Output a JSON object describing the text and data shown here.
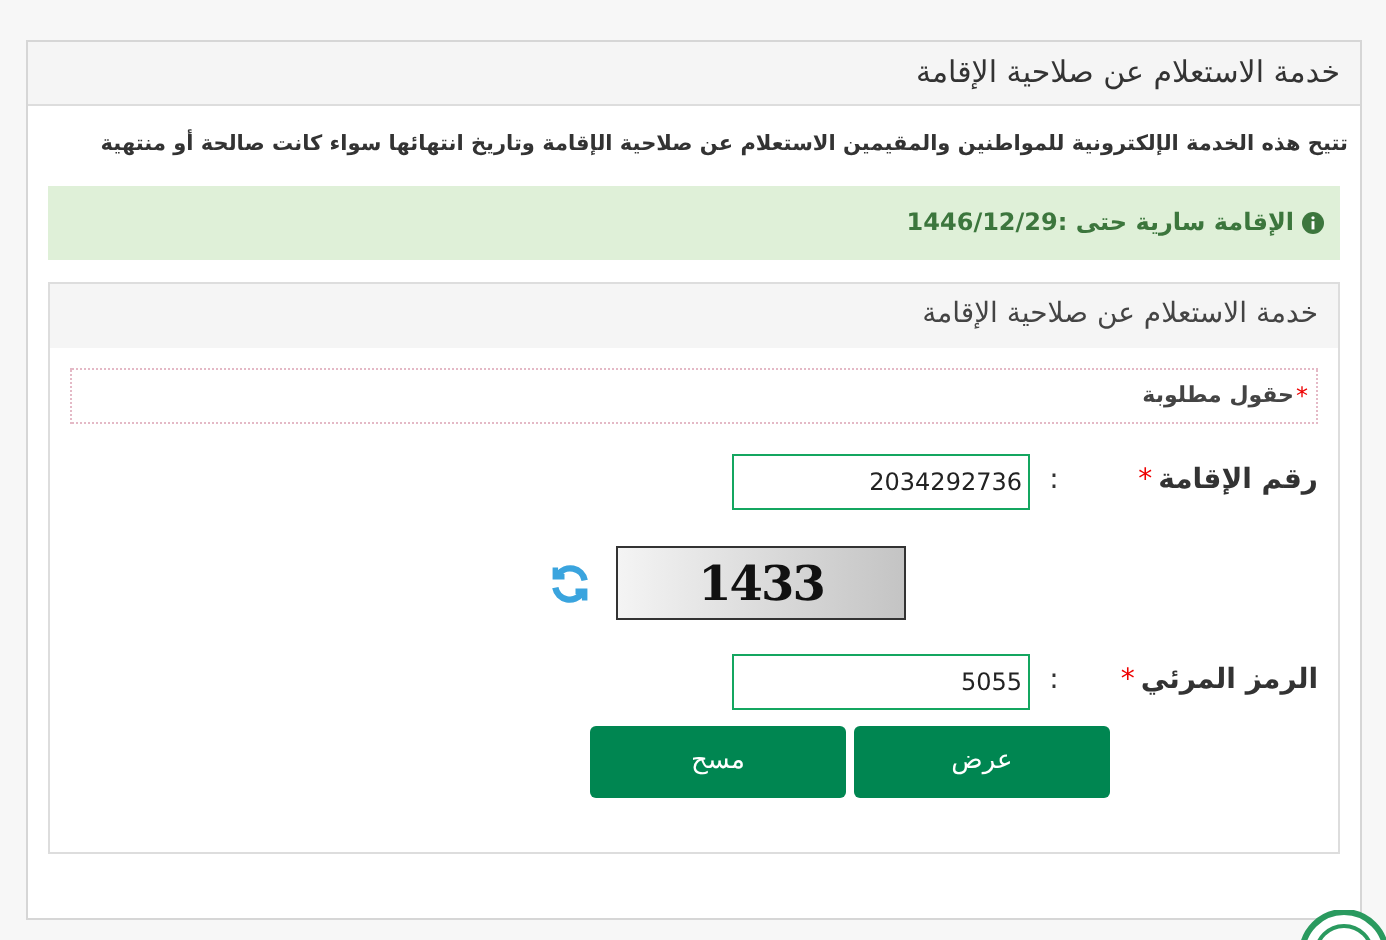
{
  "panel": {
    "title": "خدمة الاستعلام عن صلاحية الإقامة"
  },
  "description": "تتيح هذه الخدمة الإلكترونية للمواطنين والمقيمين الاستعلام عن صلاحية الإقامة وتاريخ انتهائها سواء كانت صالحة أو منتهية",
  "alert": {
    "kind": "success",
    "text": "الإقامة سارية حتى :1446/12/29"
  },
  "form": {
    "title": "خدمة الاستعلام عن صلاحية الإقامة",
    "required_note": {
      "mark": "*",
      "text": "حقول مطلوبة"
    },
    "fields": [
      {
        "kind": "text",
        "label": "رقم الإقامة",
        "required": true,
        "separator": ":",
        "value": "2034292736"
      },
      {
        "kind": "captcha",
        "code": "1433"
      },
      {
        "kind": "text",
        "label": "الرمز المرئي",
        "required": true,
        "separator": ":",
        "value": "5055"
      }
    ],
    "buttons": [
      "عرض",
      "مسح"
    ]
  }
}
